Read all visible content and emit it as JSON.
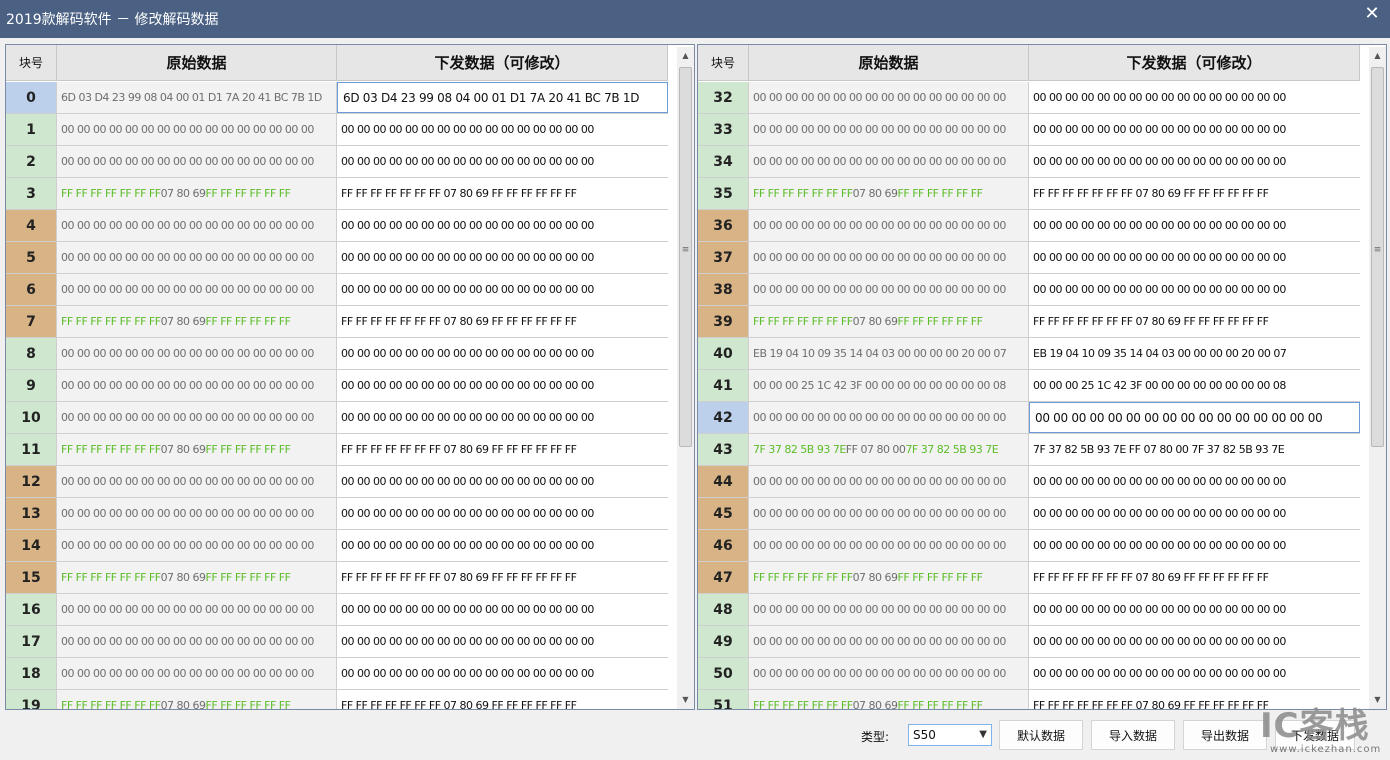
{
  "window": {
    "title": "2019款解码软件 － 修改解码数据",
    "close_glyph": "✕"
  },
  "table": {
    "headers": {
      "index": "块号",
      "original": "原始数据",
      "send": "下发数据（可修改）"
    }
  },
  "left_rows": [
    {
      "idx": "0",
      "color": "blue",
      "orig": "6D 03 D4 23 99 08 04 00 01 D1 7A 20 41 BC 7B 1D",
      "send": "6D 03 D4 23 99 08 04 00 01 D1 7A 20 41 BC 7B 1D",
      "editing": true
    },
    {
      "idx": "1",
      "color": "green",
      "orig": "00 00 00 00 00 00 00 00 00 00 00 00 00 00 00 00",
      "send": "00 00 00 00 00 00 00 00 00 00 00 00 00 00 00 00"
    },
    {
      "idx": "2",
      "color": "green",
      "orig": "00 00 00 00 00 00 00 00 00 00 00 00 00 00 00 00",
      "send": "00 00 00 00 00 00 00 00 00 00 00 00 00 00 00 00"
    },
    {
      "idx": "3",
      "color": "green",
      "orig": "FF FF FF FF FF FF FF 07 80 69 FF FF FF FF FF FF",
      "trailer": true,
      "send": "FF FF FF FF FF FF FF 07 80 69 FF FF FF FF FF FF"
    },
    {
      "idx": "4",
      "color": "tan",
      "orig": "00 00 00 00 00 00 00 00 00 00 00 00 00 00 00 00",
      "send": "00 00 00 00 00 00 00 00 00 00 00 00 00 00 00 00"
    },
    {
      "idx": "5",
      "color": "tan",
      "orig": "00 00 00 00 00 00 00 00 00 00 00 00 00 00 00 00",
      "send": "00 00 00 00 00 00 00 00 00 00 00 00 00 00 00 00"
    },
    {
      "idx": "6",
      "color": "tan",
      "orig": "00 00 00 00 00 00 00 00 00 00 00 00 00 00 00 00",
      "send": "00 00 00 00 00 00 00 00 00 00 00 00 00 00 00 00"
    },
    {
      "idx": "7",
      "color": "tan",
      "orig": "FF FF FF FF FF FF FF 07 80 69 FF FF FF FF FF FF",
      "trailer": true,
      "send": "FF FF FF FF FF FF FF 07 80 69 FF FF FF FF FF FF"
    },
    {
      "idx": "8",
      "color": "green",
      "orig": "00 00 00 00 00 00 00 00 00 00 00 00 00 00 00 00",
      "send": "00 00 00 00 00 00 00 00 00 00 00 00 00 00 00 00"
    },
    {
      "idx": "9",
      "color": "green",
      "orig": "00 00 00 00 00 00 00 00 00 00 00 00 00 00 00 00",
      "send": "00 00 00 00 00 00 00 00 00 00 00 00 00 00 00 00"
    },
    {
      "idx": "10",
      "color": "green",
      "orig": "00 00 00 00 00 00 00 00 00 00 00 00 00 00 00 00",
      "send": "00 00 00 00 00 00 00 00 00 00 00 00 00 00 00 00"
    },
    {
      "idx": "11",
      "color": "green",
      "orig": "FF FF FF FF FF FF FF 07 80 69 FF FF FF FF FF FF",
      "trailer": true,
      "send": "FF FF FF FF FF FF FF 07 80 69 FF FF FF FF FF FF"
    },
    {
      "idx": "12",
      "color": "tan",
      "orig": "00 00 00 00 00 00 00 00 00 00 00 00 00 00 00 00",
      "send": "00 00 00 00 00 00 00 00 00 00 00 00 00 00 00 00"
    },
    {
      "idx": "13",
      "color": "tan",
      "orig": "00 00 00 00 00 00 00 00 00 00 00 00 00 00 00 00",
      "send": "00 00 00 00 00 00 00 00 00 00 00 00 00 00 00 00"
    },
    {
      "idx": "14",
      "color": "tan",
      "orig": "00 00 00 00 00 00 00 00 00 00 00 00 00 00 00 00",
      "send": "00 00 00 00 00 00 00 00 00 00 00 00 00 00 00 00"
    },
    {
      "idx": "15",
      "color": "tan",
      "orig": "FF FF FF FF FF FF FF 07 80 69 FF FF FF FF FF FF",
      "trailer": true,
      "send": "FF FF FF FF FF FF FF 07 80 69 FF FF FF FF FF FF"
    },
    {
      "idx": "16",
      "color": "green",
      "orig": "00 00 00 00 00 00 00 00 00 00 00 00 00 00 00 00",
      "send": "00 00 00 00 00 00 00 00 00 00 00 00 00 00 00 00"
    },
    {
      "idx": "17",
      "color": "green",
      "orig": "00 00 00 00 00 00 00 00 00 00 00 00 00 00 00 00",
      "send": "00 00 00 00 00 00 00 00 00 00 00 00 00 00 00 00"
    },
    {
      "idx": "18",
      "color": "green",
      "orig": "00 00 00 00 00 00 00 00 00 00 00 00 00 00 00 00",
      "send": "00 00 00 00 00 00 00 00 00 00 00 00 00 00 00 00"
    },
    {
      "idx": "19",
      "color": "green",
      "orig": "FF FF FF FF FF FF FF 07 80 69 FF FF FF FF FF FF",
      "trailer": true,
      "send": "FF FF FF FF FF FF FF 07 80 69 FF FF FF FF FF FF"
    }
  ],
  "right_rows": [
    {
      "idx": "32",
      "color": "green",
      "orig": "00 00 00 00 00 00 00 00 00 00 00 00 00 00 00 00",
      "send": "00 00 00 00 00 00 00 00 00 00 00 00 00 00 00 00"
    },
    {
      "idx": "33",
      "color": "green",
      "orig": "00 00 00 00 00 00 00 00 00 00 00 00 00 00 00 00",
      "send": "00 00 00 00 00 00 00 00 00 00 00 00 00 00 00 00"
    },
    {
      "idx": "34",
      "color": "green",
      "orig": "00 00 00 00 00 00 00 00 00 00 00 00 00 00 00 00",
      "send": "00 00 00 00 00 00 00 00 00 00 00 00 00 00 00 00"
    },
    {
      "idx": "35",
      "color": "green",
      "orig": "FF FF FF FF FF FF FF 07 80 69 FF FF FF FF FF FF",
      "trailer": true,
      "send": "FF FF FF FF FF FF FF 07 80 69 FF FF FF FF FF FF"
    },
    {
      "idx": "36",
      "color": "tan",
      "orig": "00 00 00 00 00 00 00 00 00 00 00 00 00 00 00 00",
      "send": "00 00 00 00 00 00 00 00 00 00 00 00 00 00 00 00"
    },
    {
      "idx": "37",
      "color": "tan",
      "orig": "00 00 00 00 00 00 00 00 00 00 00 00 00 00 00 00",
      "send": "00 00 00 00 00 00 00 00 00 00 00 00 00 00 00 00"
    },
    {
      "idx": "38",
      "color": "tan",
      "orig": "00 00 00 00 00 00 00 00 00 00 00 00 00 00 00 00",
      "send": "00 00 00 00 00 00 00 00 00 00 00 00 00 00 00 00"
    },
    {
      "idx": "39",
      "color": "tan",
      "orig": "FF FF FF FF FF FF FF 07 80 69 FF FF FF FF FF FF",
      "trailer": true,
      "send": "FF FF FF FF FF FF FF 07 80 69 FF FF FF FF FF FF"
    },
    {
      "idx": "40",
      "color": "green",
      "orig": "EB 19 04 10 09 35 14 04 03 00 00 00 00 20 00 07",
      "send": "EB 19 04 10 09 35 14 04 03 00 00 00 00 20 00 07"
    },
    {
      "idx": "41",
      "color": "green",
      "orig": "00 00 00 25 1C 42 3F 00 00 00 00 00 00 00 00 08",
      "send": "00 00 00 25 1C 42 3F 00 00 00 00 00 00 00 00 08"
    },
    {
      "idx": "42",
      "color": "blue",
      "orig": "00 00 00 00 00 00 00 00 00 00 00 00 00 00 00 00",
      "send": "00 00 00 00 00 00 00 00 00 00 00 00 00 00 00 00",
      "editing": true
    },
    {
      "idx": "43",
      "color": "green",
      "orig_parts": [
        {
          "t": "7F 37 82 5B 93 7E",
          "g": true
        },
        {
          "t": " FF 07 80 00 ",
          "g": false
        },
        {
          "t": "7F 37 82 5B 93 7E",
          "g": true
        }
      ],
      "send": "7F 37 82 5B 93 7E FF 07 80 00 7F 37 82 5B 93 7E"
    },
    {
      "idx": "44",
      "color": "tan",
      "orig": "00 00 00 00 00 00 00 00 00 00 00 00 00 00 00 00",
      "send": "00 00 00 00 00 00 00 00 00 00 00 00 00 00 00 00"
    },
    {
      "idx": "45",
      "color": "tan",
      "orig": "00 00 00 00 00 00 00 00 00 00 00 00 00 00 00 00",
      "send": "00 00 00 00 00 00 00 00 00 00 00 00 00 00 00 00"
    },
    {
      "idx": "46",
      "color": "tan",
      "orig": "00 00 00 00 00 00 00 00 00 00 00 00 00 00 00 00",
      "send": "00 00 00 00 00 00 00 00 00 00 00 00 00 00 00 00"
    },
    {
      "idx": "47",
      "color": "tan",
      "orig": "FF FF FF FF FF FF FF 07 80 69 FF FF FF FF FF FF",
      "trailer": true,
      "send": "FF FF FF FF FF FF FF 07 80 69 FF FF FF FF FF FF"
    },
    {
      "idx": "48",
      "color": "green",
      "orig": "00 00 00 00 00 00 00 00 00 00 00 00 00 00 00 00",
      "send": "00 00 00 00 00 00 00 00 00 00 00 00 00 00 00 00"
    },
    {
      "idx": "49",
      "color": "green",
      "orig": "00 00 00 00 00 00 00 00 00 00 00 00 00 00 00 00",
      "send": "00 00 00 00 00 00 00 00 00 00 00 00 00 00 00 00"
    },
    {
      "idx": "50",
      "color": "green",
      "orig": "00 00 00 00 00 00 00 00 00 00 00 00 00 00 00 00",
      "send": "00 00 00 00 00 00 00 00 00 00 00 00 00 00 00 00"
    },
    {
      "idx": "51",
      "color": "green",
      "orig": "FF FF FF FF FF FF FF 07 80 69 FF FF FF FF FF FF",
      "trailer": true,
      "send": "FF FF FF FF FF FF FF 07 80 69 FF FF FF FF FF FF"
    }
  ],
  "scrollbar": {
    "up": "▲",
    "down": "▼",
    "grip": "≡"
  },
  "footer": {
    "type_label": "类型:",
    "type_value": "S50",
    "caret": "▼",
    "default_button": "默认数据",
    "import_button": "导入数据",
    "export_button": "导出数据",
    "send_button": "下发数据"
  },
  "watermark": {
    "big": "IC客栈",
    "small": "www.ickezhan.com"
  },
  "colors": {
    "titlebar": "#4a6184",
    "index_green": "#cfe6cf",
    "index_tan": "#d8b385",
    "index_selected": "#bcd0ec",
    "trailer_green": "#5cbd2a"
  }
}
